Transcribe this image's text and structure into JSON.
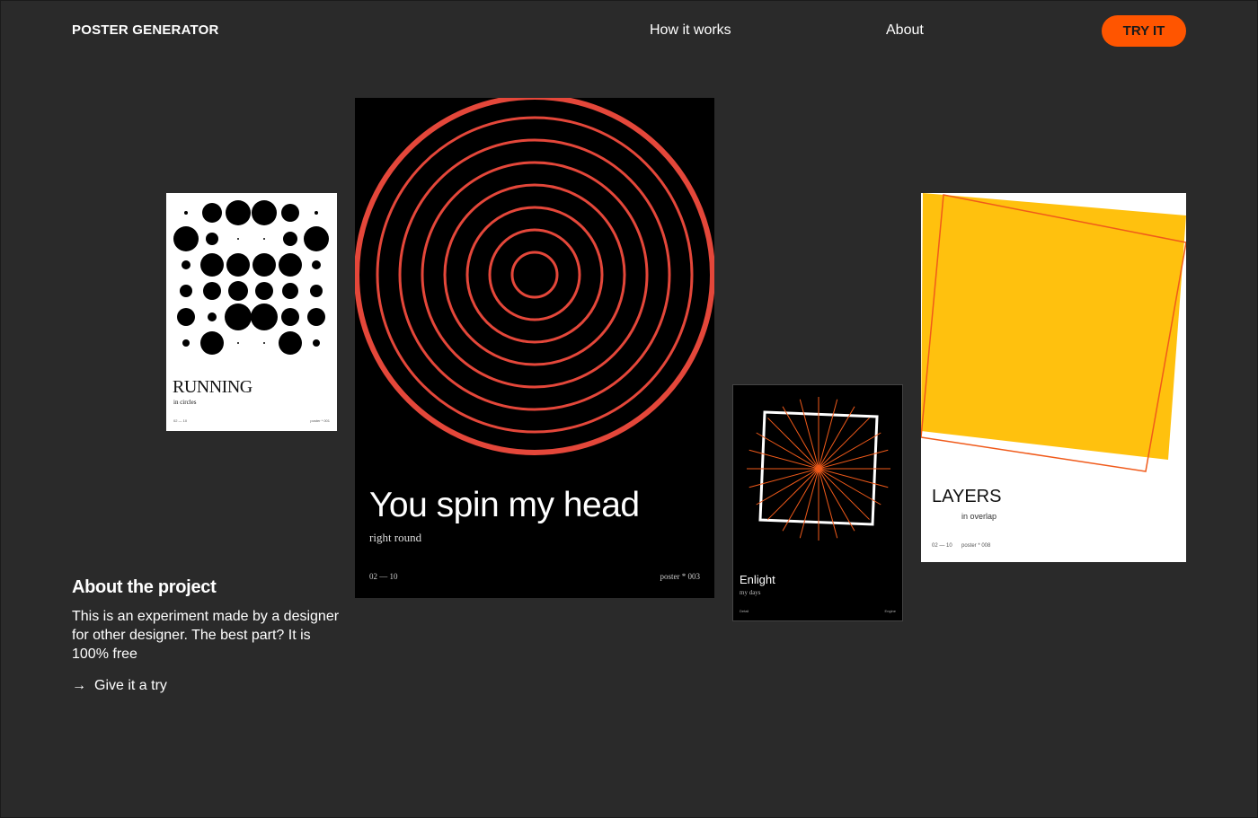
{
  "header": {
    "brand": "POSTER GENERATOR",
    "nav": {
      "how": "How it works",
      "about": "About"
    },
    "cta_label": "TRY IT"
  },
  "colors": {
    "background": "#2a2a2a",
    "accent": "#ff5500",
    "ring_red": "#e4473a",
    "yellow": "#ffc10e",
    "orange_line": "#f05a1a"
  },
  "posters": {
    "running": {
      "title": "RUNNING",
      "subtitle": "in circles",
      "foot_left": "02 — 10",
      "foot_right": "poster * 001"
    },
    "spin": {
      "title": "You spin my head",
      "subtitle": "right round",
      "foot_left": "02 — 10",
      "foot_right": "poster * 003"
    },
    "enlight": {
      "title": "Enlight",
      "subtitle": "my days",
      "foot_left": "Detail",
      "foot_right": "Engine"
    },
    "layers": {
      "title": "LAYERS",
      "subtitle": "in overlap",
      "foot_left": "02 — 10",
      "foot_right": "poster * 008"
    }
  },
  "about": {
    "title": "About the project",
    "body": "This is an experiment made by a designer for other designer. The best part? It is 100% free",
    "cta_icon": "arrow-right-icon",
    "cta_label": "Give it a try"
  }
}
